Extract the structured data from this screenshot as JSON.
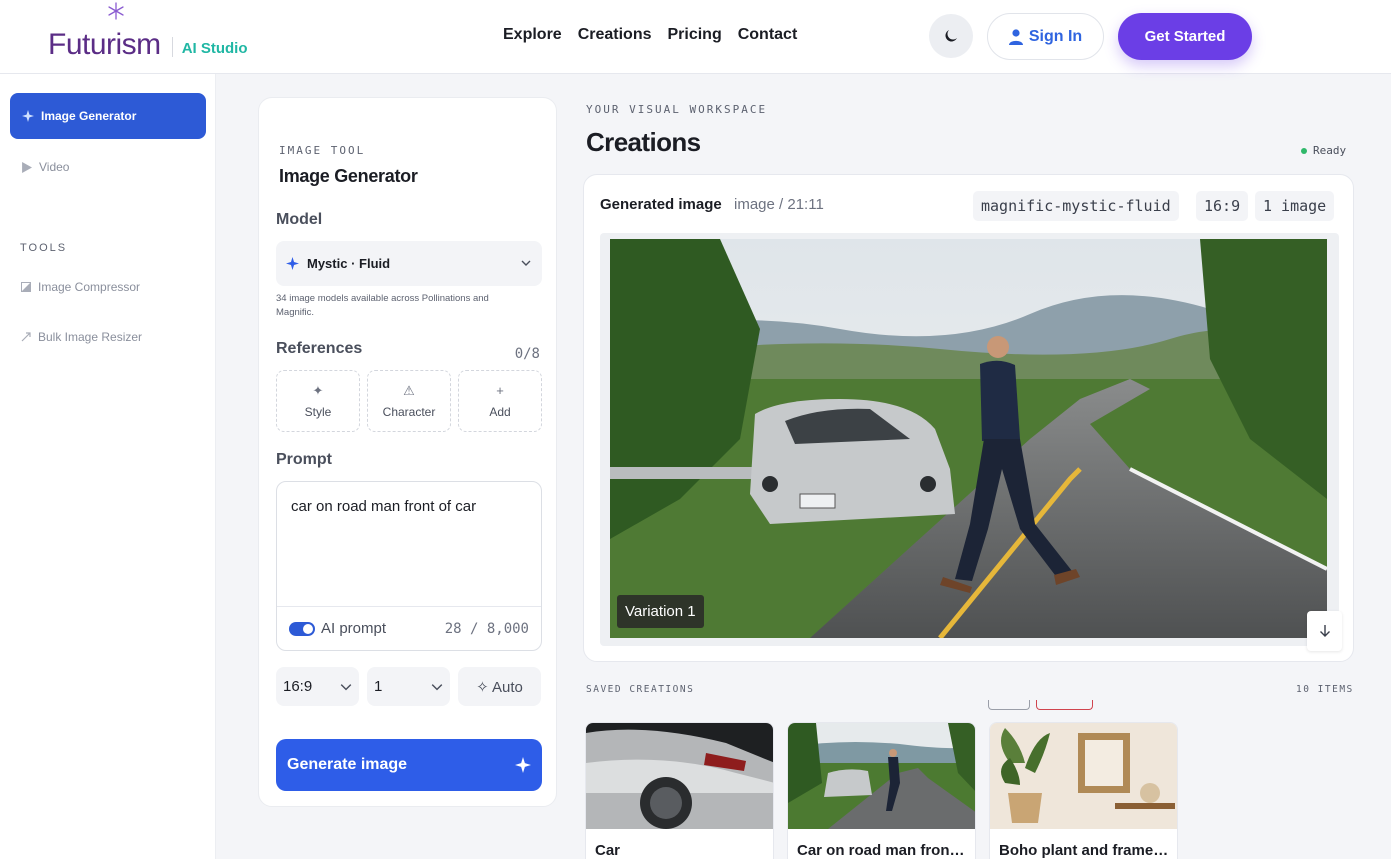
{
  "brand": {
    "name": "Futurism",
    "product": "AI Studio"
  },
  "nav": {
    "items": [
      "Explore",
      "Creations",
      "Pricing",
      "Contact"
    ]
  },
  "header": {
    "sign_in": "Sign In",
    "get_started": "Get Started",
    "theme_icon": "moon-icon"
  },
  "sidebar": {
    "active": {
      "label": "Image Generator",
      "icon": "sparkle-icon"
    },
    "items": [
      {
        "label": "Video",
        "icon": "play-icon"
      }
    ],
    "tools_title": "TOOLS",
    "tools": [
      {
        "label": "Image Compressor",
        "icon": "compress-icon"
      },
      {
        "label": "Bulk Image Resizer",
        "icon": "resize-icon"
      }
    ]
  },
  "panel": {
    "kicker": "IMAGE TOOL",
    "title": "Image Generator",
    "model_label": "Model",
    "model_value": "Mystic · Fluid",
    "model_note": "34 image models available across Pollinations and Magnific.",
    "references_label": "References",
    "references_count": "0/8",
    "references": [
      {
        "label": "Style",
        "icon": "✦"
      },
      {
        "label": "Character",
        "icon": "⚠"
      },
      {
        "label": "Add",
        "icon": "+"
      }
    ],
    "prompt_label": "Prompt",
    "prompt_value": "car on road man front of car",
    "ai_prompt_label": "AI prompt",
    "ai_prompt_on": true,
    "char_count": "28 / 8,000",
    "aspect": "16:9",
    "count": "1",
    "quality": "✧ Auto",
    "generate": "Generate image"
  },
  "workspace": {
    "kicker": "YOUR VISUAL WORKSPACE",
    "title": "Creations",
    "status": "Ready",
    "card": {
      "title": "Generated image",
      "meta": "image / 21:11",
      "chips": [
        "magnific-mystic-fluid",
        "16:9",
        "1 image"
      ],
      "variation": "Variation 1"
    },
    "saved_kicker": "SAVED CREATIONS",
    "saved_count": "10 ITEMS",
    "saved": [
      {
        "title": "Car"
      },
      {
        "title": "Car on road man front of car"
      },
      {
        "title": "Boho plant and frame wall decor"
      }
    ]
  },
  "colors": {
    "brand_purple": "#5b2d86",
    "accent_teal": "#20b7a4",
    "primary_blue": "#2e5de8",
    "cta_purple": "#6b3ee6",
    "status_green": "#2fb86a"
  }
}
